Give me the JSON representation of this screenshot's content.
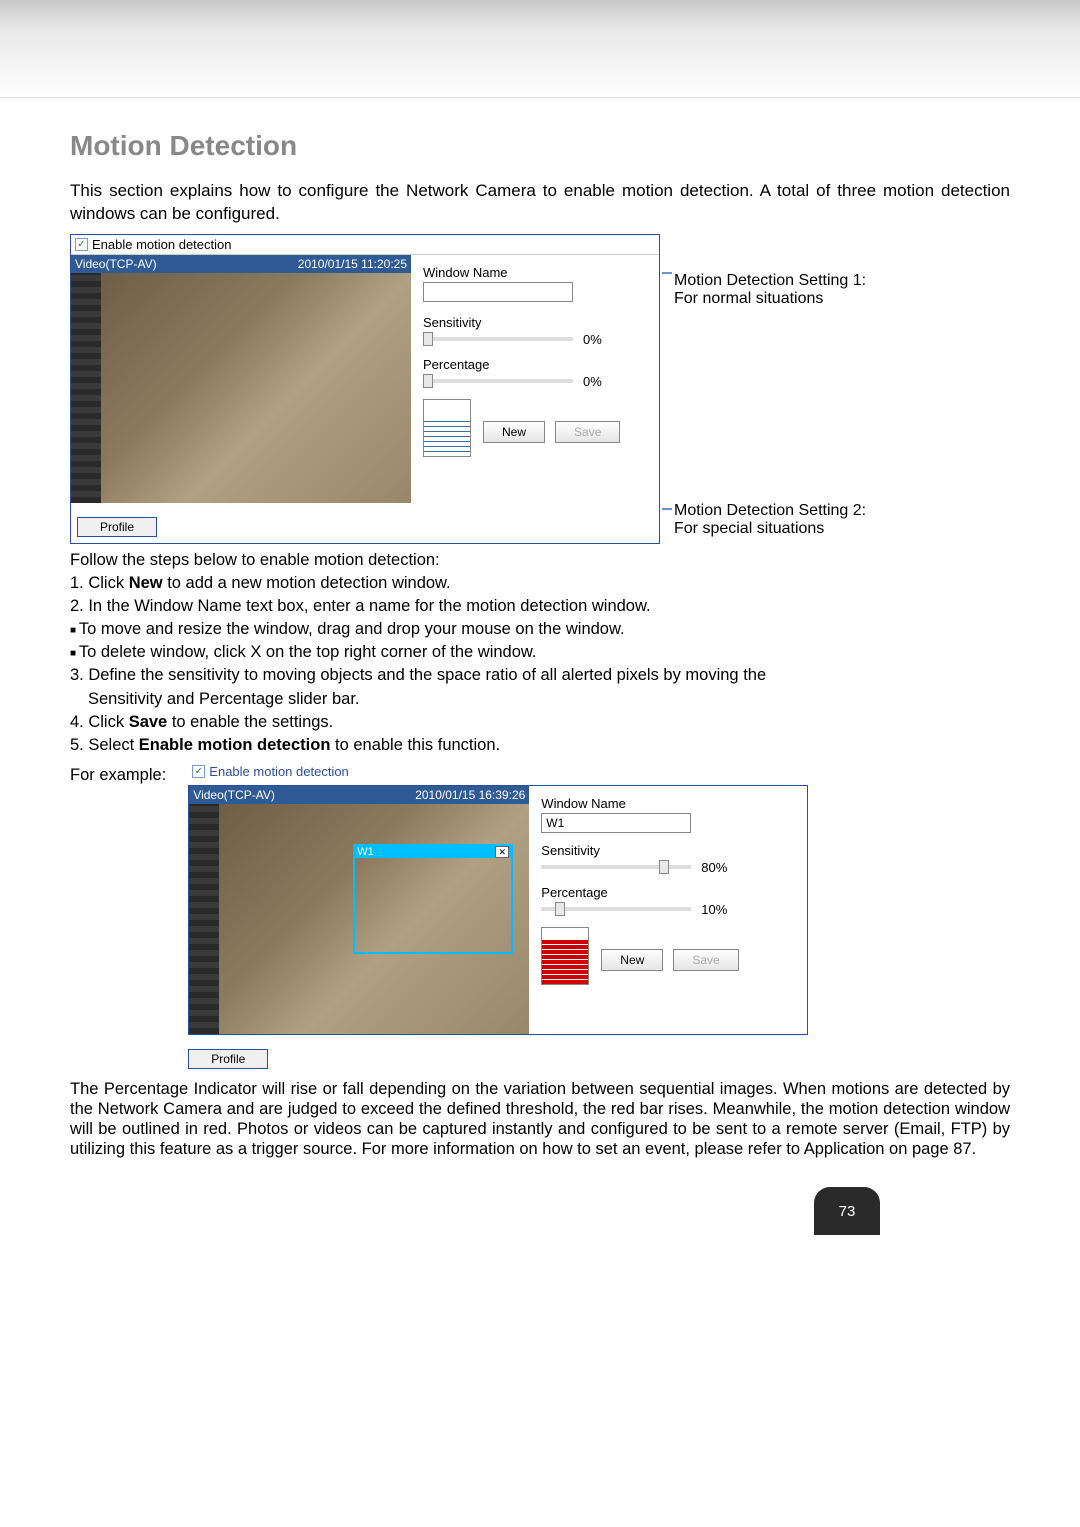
{
  "section_title": "Motion Detection",
  "intro": "This section explains how to configure the Network Camera to enable motion detection. A total of three motion detection windows can be configured.",
  "panel1": {
    "enable_label": "Enable motion detection",
    "video_source": "Video(TCP-AV)",
    "timestamp": "2010/01/15 11:20:25",
    "window_name_label": "Window Name",
    "window_name_value": "",
    "sensitivity_label": "Sensitivity",
    "sensitivity_value": "0%",
    "percentage_label": "Percentage",
    "percentage_value": "0%",
    "new_btn": "New",
    "save_btn": "Save",
    "profile_btn": "Profile"
  },
  "anno": {
    "setting1_line1": "Motion Detection Setting 1:",
    "setting1_line2": "For normal situations",
    "setting2_line1": "Motion Detection Setting 2:",
    "setting2_line2": "For special situations"
  },
  "steps": {
    "lead": "Follow the steps below to enable motion detection:",
    "s1a": "1. Click ",
    "s1b": "New",
    "s1c": " to add a new motion detection window.",
    "s2": "2. In the Window Name text box, enter a name for the motion detection window.",
    "s2a": "To move and resize the window, drag and drop your mouse on the window.",
    "s2b": "To delete window, click X on the top right corner of the window.",
    "s3a": "3. Define the sensitivity to moving objects and the space ratio of all alerted pixels by moving the",
    "s3b": "Sensitivity and Percentage slider bar.",
    "s4a": "4. Click ",
    "s4b": "Save",
    "s4c": " to enable the settings.",
    "s5a": "5. Select ",
    "s5b": "Enable motion detection",
    "s5c": " to enable this function."
  },
  "for_example": "For example:",
  "panel2": {
    "enable_label": "Enable motion detection",
    "video_source": "Video(TCP-AV)",
    "timestamp": "2010/01/15 16:39:26",
    "md_window_label": "W1",
    "window_name_label": "Window Name",
    "window_name_value": "W1",
    "sensitivity_label": "Sensitivity",
    "sensitivity_value": "80%",
    "percentage_label": "Percentage",
    "percentage_value": "10%",
    "new_btn": "New",
    "save_btn": "Save",
    "profile_btn": "Profile"
  },
  "paragraph": "The Percentage Indicator will rise or fall depending on the variation between sequential images. When motions are detected by the Network Camera and are judged to exceed the defined threshold, the red bar rises. Meanwhile, the motion detection window will be outlined in red. Photos or videos can be captured instantly and configured to be sent to a remote server (Email, FTP) by utilizing this feature as a trigger source. For more information on how to set an event, please refer to Application on page 87.",
  "page_number": "73"
}
